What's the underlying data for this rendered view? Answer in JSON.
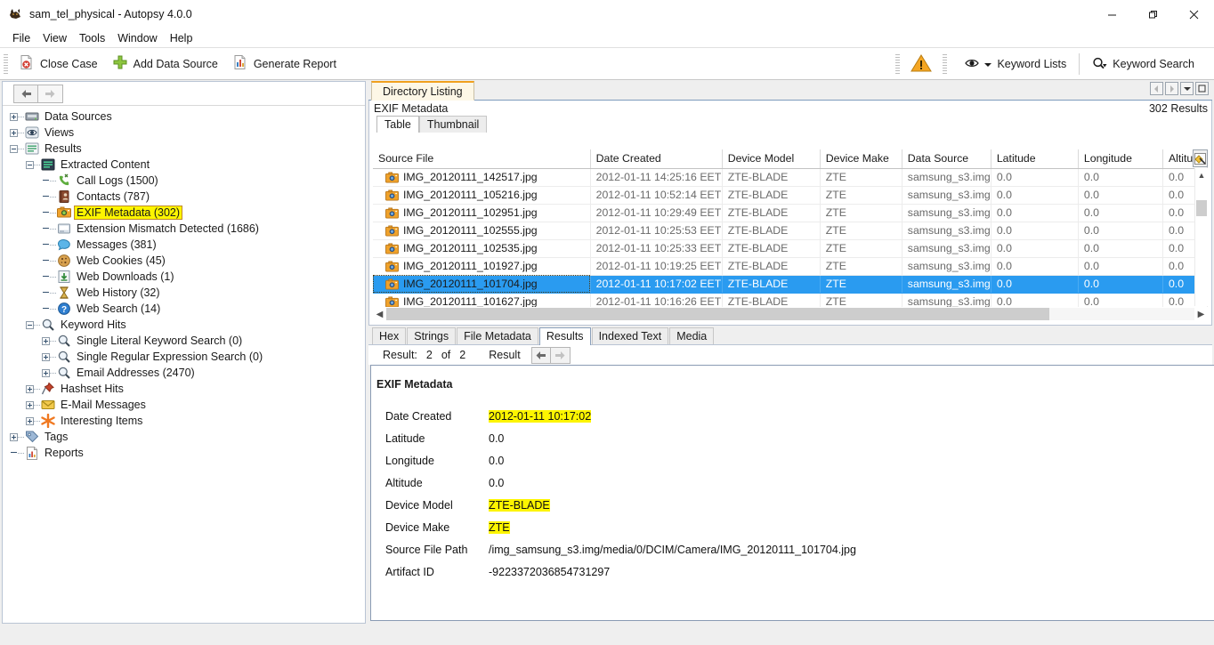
{
  "window": {
    "title": "sam_tel_physical - Autopsy 4.0.0",
    "minimize_label": "—",
    "maximize_label": "❐",
    "close_label": "✕"
  },
  "menu": {
    "items": [
      "File",
      "View",
      "Tools",
      "Window",
      "Help"
    ]
  },
  "toolbar": {
    "close_case": "Close Case",
    "add_data_source": "Add Data Source",
    "generate_report": "Generate Report",
    "keyword_lists": "Keyword Lists",
    "keyword_search": "Keyword Search"
  },
  "tree": {
    "nav_back": "←",
    "nav_forward": "→",
    "nodes": [
      {
        "label": "Data Sources",
        "indent": 0,
        "expander": "plus",
        "icon": "drive-icon",
        "highlight": false
      },
      {
        "label": "Views",
        "indent": 0,
        "expander": "plus",
        "icon": "eye-icon",
        "highlight": false
      },
      {
        "label": "Results",
        "indent": 0,
        "expander": "minus",
        "icon": "results-icon",
        "highlight": false
      },
      {
        "label": "Extracted Content",
        "indent": 1,
        "expander": "minus",
        "icon": "extracted-icon",
        "highlight": false
      },
      {
        "label": "Call Logs (1500)",
        "indent": 2,
        "expander": "leaf",
        "icon": "phone-icon",
        "highlight": false
      },
      {
        "label": "Contacts (787)",
        "indent": 2,
        "expander": "leaf",
        "icon": "contacts-icon",
        "highlight": false
      },
      {
        "label": "EXIF Metadata (302)",
        "indent": 2,
        "expander": "leaf",
        "icon": "camera-icon",
        "highlight": true
      },
      {
        "label": "Extension Mismatch Detected (1686)",
        "indent": 2,
        "expander": "leaf",
        "icon": "file-icon",
        "highlight": false
      },
      {
        "label": "Messages (381)",
        "indent": 2,
        "expander": "leaf",
        "icon": "message-icon",
        "highlight": false
      },
      {
        "label": "Web Cookies (45)",
        "indent": 2,
        "expander": "leaf",
        "icon": "cookie-icon",
        "highlight": false
      },
      {
        "label": "Web Downloads (1)",
        "indent": 2,
        "expander": "leaf",
        "icon": "download-icon",
        "highlight": false
      },
      {
        "label": "Web History (32)",
        "indent": 2,
        "expander": "leaf",
        "icon": "hourglass-icon",
        "highlight": false
      },
      {
        "label": "Web Search (14)",
        "indent": 2,
        "expander": "leaf",
        "icon": "question-icon",
        "highlight": false
      },
      {
        "label": "Keyword Hits",
        "indent": 1,
        "expander": "minus",
        "icon": "search-icon",
        "highlight": false
      },
      {
        "label": "Single Literal Keyword Search (0)",
        "indent": 2,
        "expander": "plus",
        "icon": "search-icon",
        "highlight": false
      },
      {
        "label": "Single Regular Expression Search (0)",
        "indent": 2,
        "expander": "plus",
        "icon": "search-icon",
        "highlight": false
      },
      {
        "label": "Email Addresses (2470)",
        "indent": 2,
        "expander": "plus",
        "icon": "search-icon",
        "highlight": false
      },
      {
        "label": "Hashset Hits",
        "indent": 1,
        "expander": "plus",
        "icon": "pin-icon",
        "highlight": false
      },
      {
        "label": "E-Mail Messages",
        "indent": 1,
        "expander": "plus",
        "icon": "mail-icon",
        "highlight": false
      },
      {
        "label": "Interesting Items",
        "indent": 1,
        "expander": "plus",
        "icon": "star-icon",
        "highlight": false
      },
      {
        "label": "Tags",
        "indent": 0,
        "expander": "plus",
        "icon": "tag-icon",
        "highlight": false
      },
      {
        "label": "Reports",
        "indent": 0,
        "expander": "leaf",
        "icon": "report-icon",
        "highlight": false
      }
    ]
  },
  "directory_listing": {
    "tab_label": "Directory Listing",
    "title": "EXIF Metadata",
    "results_count": "302  Results",
    "view_tabs": [
      {
        "label": "Table",
        "active": true
      },
      {
        "label": "Thumbnail",
        "active": false
      }
    ],
    "window_buttons": [
      "◀",
      "▶",
      "▼",
      "□"
    ],
    "columns": [
      "Source File",
      "Date Created",
      "Device Model",
      "Device Make",
      "Data Source",
      "Latitude",
      "Longitude",
      "Altitude"
    ],
    "rows": [
      {
        "source_file": "IMG_20120111_142517.jpg",
        "date_created": "2012-01-11 14:25:16 EET",
        "device_model": "ZTE-BLADE",
        "device_make": "ZTE",
        "data_source": "samsung_s3.img",
        "latitude": "0.0",
        "longitude": "0.0",
        "altitude": "0.0",
        "selected": false
      },
      {
        "source_file": "IMG_20120111_105216.jpg",
        "date_created": "2012-01-11 10:52:14 EET",
        "device_model": "ZTE-BLADE",
        "device_make": "ZTE",
        "data_source": "samsung_s3.img",
        "latitude": "0.0",
        "longitude": "0.0",
        "altitude": "0.0",
        "selected": false
      },
      {
        "source_file": "IMG_20120111_102951.jpg",
        "date_created": "2012-01-11 10:29:49 EET",
        "device_model": "ZTE-BLADE",
        "device_make": "ZTE",
        "data_source": "samsung_s3.img",
        "latitude": "0.0",
        "longitude": "0.0",
        "altitude": "0.0",
        "selected": false
      },
      {
        "source_file": "IMG_20120111_102555.jpg",
        "date_created": "2012-01-11 10:25:53 EET",
        "device_model": "ZTE-BLADE",
        "device_make": "ZTE",
        "data_source": "samsung_s3.img",
        "latitude": "0.0",
        "longitude": "0.0",
        "altitude": "0.0",
        "selected": false
      },
      {
        "source_file": "IMG_20120111_102535.jpg",
        "date_created": "2012-01-11 10:25:33 EET",
        "device_model": "ZTE-BLADE",
        "device_make": "ZTE",
        "data_source": "samsung_s3.img",
        "latitude": "0.0",
        "longitude": "0.0",
        "altitude": "0.0",
        "selected": false
      },
      {
        "source_file": "IMG_20120111_101927.jpg",
        "date_created": "2012-01-11 10:19:25 EET",
        "device_model": "ZTE-BLADE",
        "device_make": "ZTE",
        "data_source": "samsung_s3.img",
        "latitude": "0.0",
        "longitude": "0.0",
        "altitude": "0.0",
        "selected": false
      },
      {
        "source_file": "IMG_20120111_101704.jpg",
        "date_created": "2012-01-11 10:17:02 EET",
        "device_model": "ZTE-BLADE",
        "device_make": "ZTE",
        "data_source": "samsung_s3.img",
        "latitude": "0.0",
        "longitude": "0.0",
        "altitude": "0.0",
        "selected": true
      },
      {
        "source_file": "IMG_20120111_101627.jpg",
        "date_created": "2012-01-11 10:16:26 EET",
        "device_model": "ZTE-BLADE",
        "device_make": "ZTE",
        "data_source": "samsung_s3.img",
        "latitude": "0.0",
        "longitude": "0.0",
        "altitude": "0.0",
        "selected": false
      }
    ]
  },
  "content_viewer": {
    "tabs": [
      {
        "label": "Hex",
        "active": false
      },
      {
        "label": "Strings",
        "active": false
      },
      {
        "label": "File Metadata",
        "active": false
      },
      {
        "label": "Results",
        "active": true
      },
      {
        "label": "Indexed Text",
        "active": false
      },
      {
        "label": "Media",
        "active": false
      }
    ],
    "result_label": "Result:",
    "result_index": "2",
    "result_of": "of",
    "result_total": "2",
    "result_word": "Result",
    "prev_arrow": "←",
    "next_arrow": "→",
    "panel_title": "EXIF Metadata",
    "fields": [
      {
        "key": "Date Created",
        "value": "2012-01-11 10:17:02",
        "highlight": true
      },
      {
        "key": "Latitude",
        "value": "0.0",
        "highlight": false
      },
      {
        "key": "Longitude",
        "value": "0.0",
        "highlight": false
      },
      {
        "key": "Altitude",
        "value": "0.0",
        "highlight": false
      },
      {
        "key": "Device Model",
        "value": "ZTE-BLADE",
        "highlight": true
      },
      {
        "key": "Device Make",
        "value": "ZTE",
        "highlight": true
      },
      {
        "key": "Source File Path",
        "value": "/img_samsung_s3.img/media/0/DCIM/Camera/IMG_20120111_101704.jpg",
        "highlight": false
      },
      {
        "key": "Artifact ID",
        "value": "-9223372036854731297",
        "highlight": false
      }
    ]
  },
  "colors": {
    "selection_blue": "#2a9bf0",
    "highlight_yellow": "#fdf500",
    "tab_accent_orange": "#f0a01e",
    "panel_border": "#b9c4d4"
  }
}
